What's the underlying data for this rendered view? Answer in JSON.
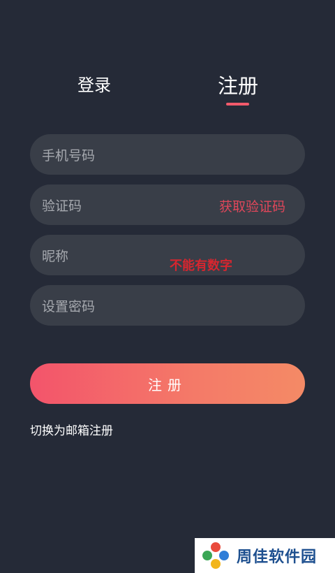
{
  "tabs": {
    "login_label": "登录",
    "register_label": "注册"
  },
  "form": {
    "phone_placeholder": "手机号码",
    "code_placeholder": "验证码",
    "get_code_label": "获取验证码",
    "nickname_placeholder": "昵称",
    "nickname_note": "不能有数字",
    "password_placeholder": "设置密码"
  },
  "submit_label": "注册",
  "switch_label": "切换为邮箱注册",
  "watermark": {
    "text": "周佳软件园"
  },
  "colors": {
    "background": "#252a37",
    "field": "#393e48",
    "accent": "#f25a6b",
    "button_gradient_start": "#f3546b",
    "button_gradient_end": "#f48a66"
  }
}
